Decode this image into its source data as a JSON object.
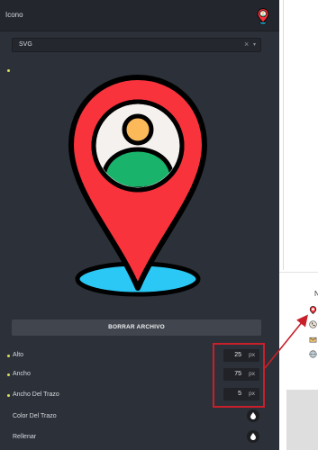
{
  "panel": {
    "title": "Icono"
  },
  "select": {
    "value": "SVG",
    "clear_glyph": "×",
    "caret_glyph": "▾"
  },
  "preview": {
    "icon": "map-pin-user-icon",
    "colors": {
      "pin": "#f8333c",
      "stroke": "#000000",
      "inner_circle": "#f4f1ee",
      "person_head": "#fcb95a",
      "person_body": "#19b36b",
      "base": "#2bc8f5"
    }
  },
  "actions": {
    "delete_file_label": "BORRAR ARCHIVO"
  },
  "fields": {
    "alto": {
      "label": "Alto",
      "value": "25",
      "unit": "px"
    },
    "ancho": {
      "label": "Ancho",
      "value": "75",
      "unit": "px"
    },
    "ancho_trazo": {
      "label": "Ancho Del Trazo",
      "value": "5",
      "unit": "px"
    },
    "color_trazo": {
      "label": "Color Del Trazo",
      "icon": "droplet-icon"
    },
    "rellenar": {
      "label": "Rellenar",
      "icon": "droplet-icon"
    }
  },
  "annotation": {
    "color": "#c8202a"
  },
  "right_side": {
    "letter": "N"
  }
}
